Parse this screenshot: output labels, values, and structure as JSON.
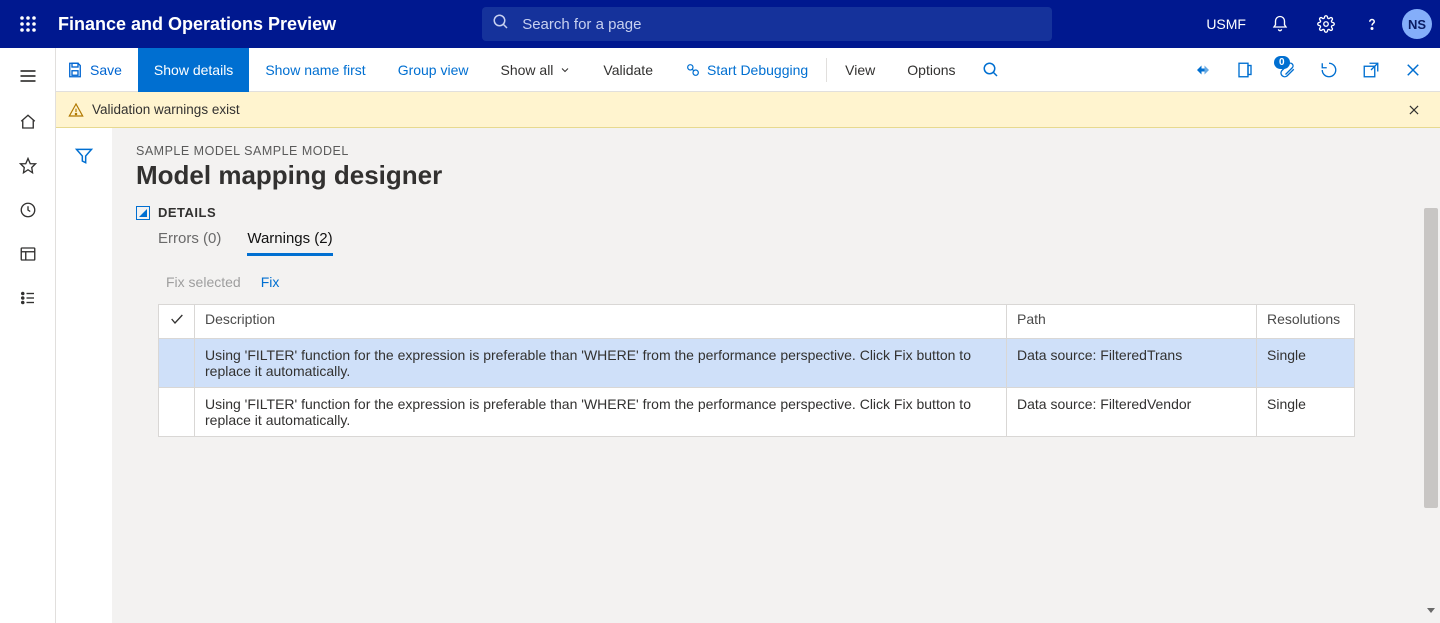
{
  "colors": {
    "header_bg": "#00188f",
    "accent": "#006fd1"
  },
  "header": {
    "title": "Finance and Operations Preview",
    "search_placeholder": "Search for a page",
    "company": "USMF",
    "avatar": "NS"
  },
  "ribbon": {
    "save": "Save",
    "show_details": "Show details",
    "show_name_first": "Show name first",
    "group_view": "Group view",
    "show_all": "Show all",
    "validate": "Validate",
    "start_debug": "Start Debugging",
    "view": "View",
    "options": "Options",
    "counter": "0"
  },
  "notify": {
    "text": "Validation warnings exist"
  },
  "page": {
    "crumb": "SAMPLE MODEL SAMPLE MODEL",
    "title": "Model mapping designer",
    "details_label": "DETAILS"
  },
  "tabs": {
    "errors_label": "Errors (0)",
    "warnings_label": "Warnings (2)"
  },
  "grid_actions": {
    "fix_selected": "Fix selected",
    "fix": "Fix"
  },
  "grid": {
    "headers": {
      "description": "Description",
      "path": "Path",
      "resolutions": "Resolutions"
    },
    "rows": [
      {
        "description": "Using 'FILTER' function for the expression is preferable than 'WHERE' from the performance perspective. Click Fix button to replace it automatically.",
        "path": "Data source: FilteredTrans",
        "resolutions": "Single",
        "selected": true
      },
      {
        "description": "Using 'FILTER' function for the expression is preferable than 'WHERE' from the performance perspective. Click Fix button to replace it automatically.",
        "path": "Data source: FilteredVendor",
        "resolutions": "Single",
        "selected": false
      }
    ]
  }
}
